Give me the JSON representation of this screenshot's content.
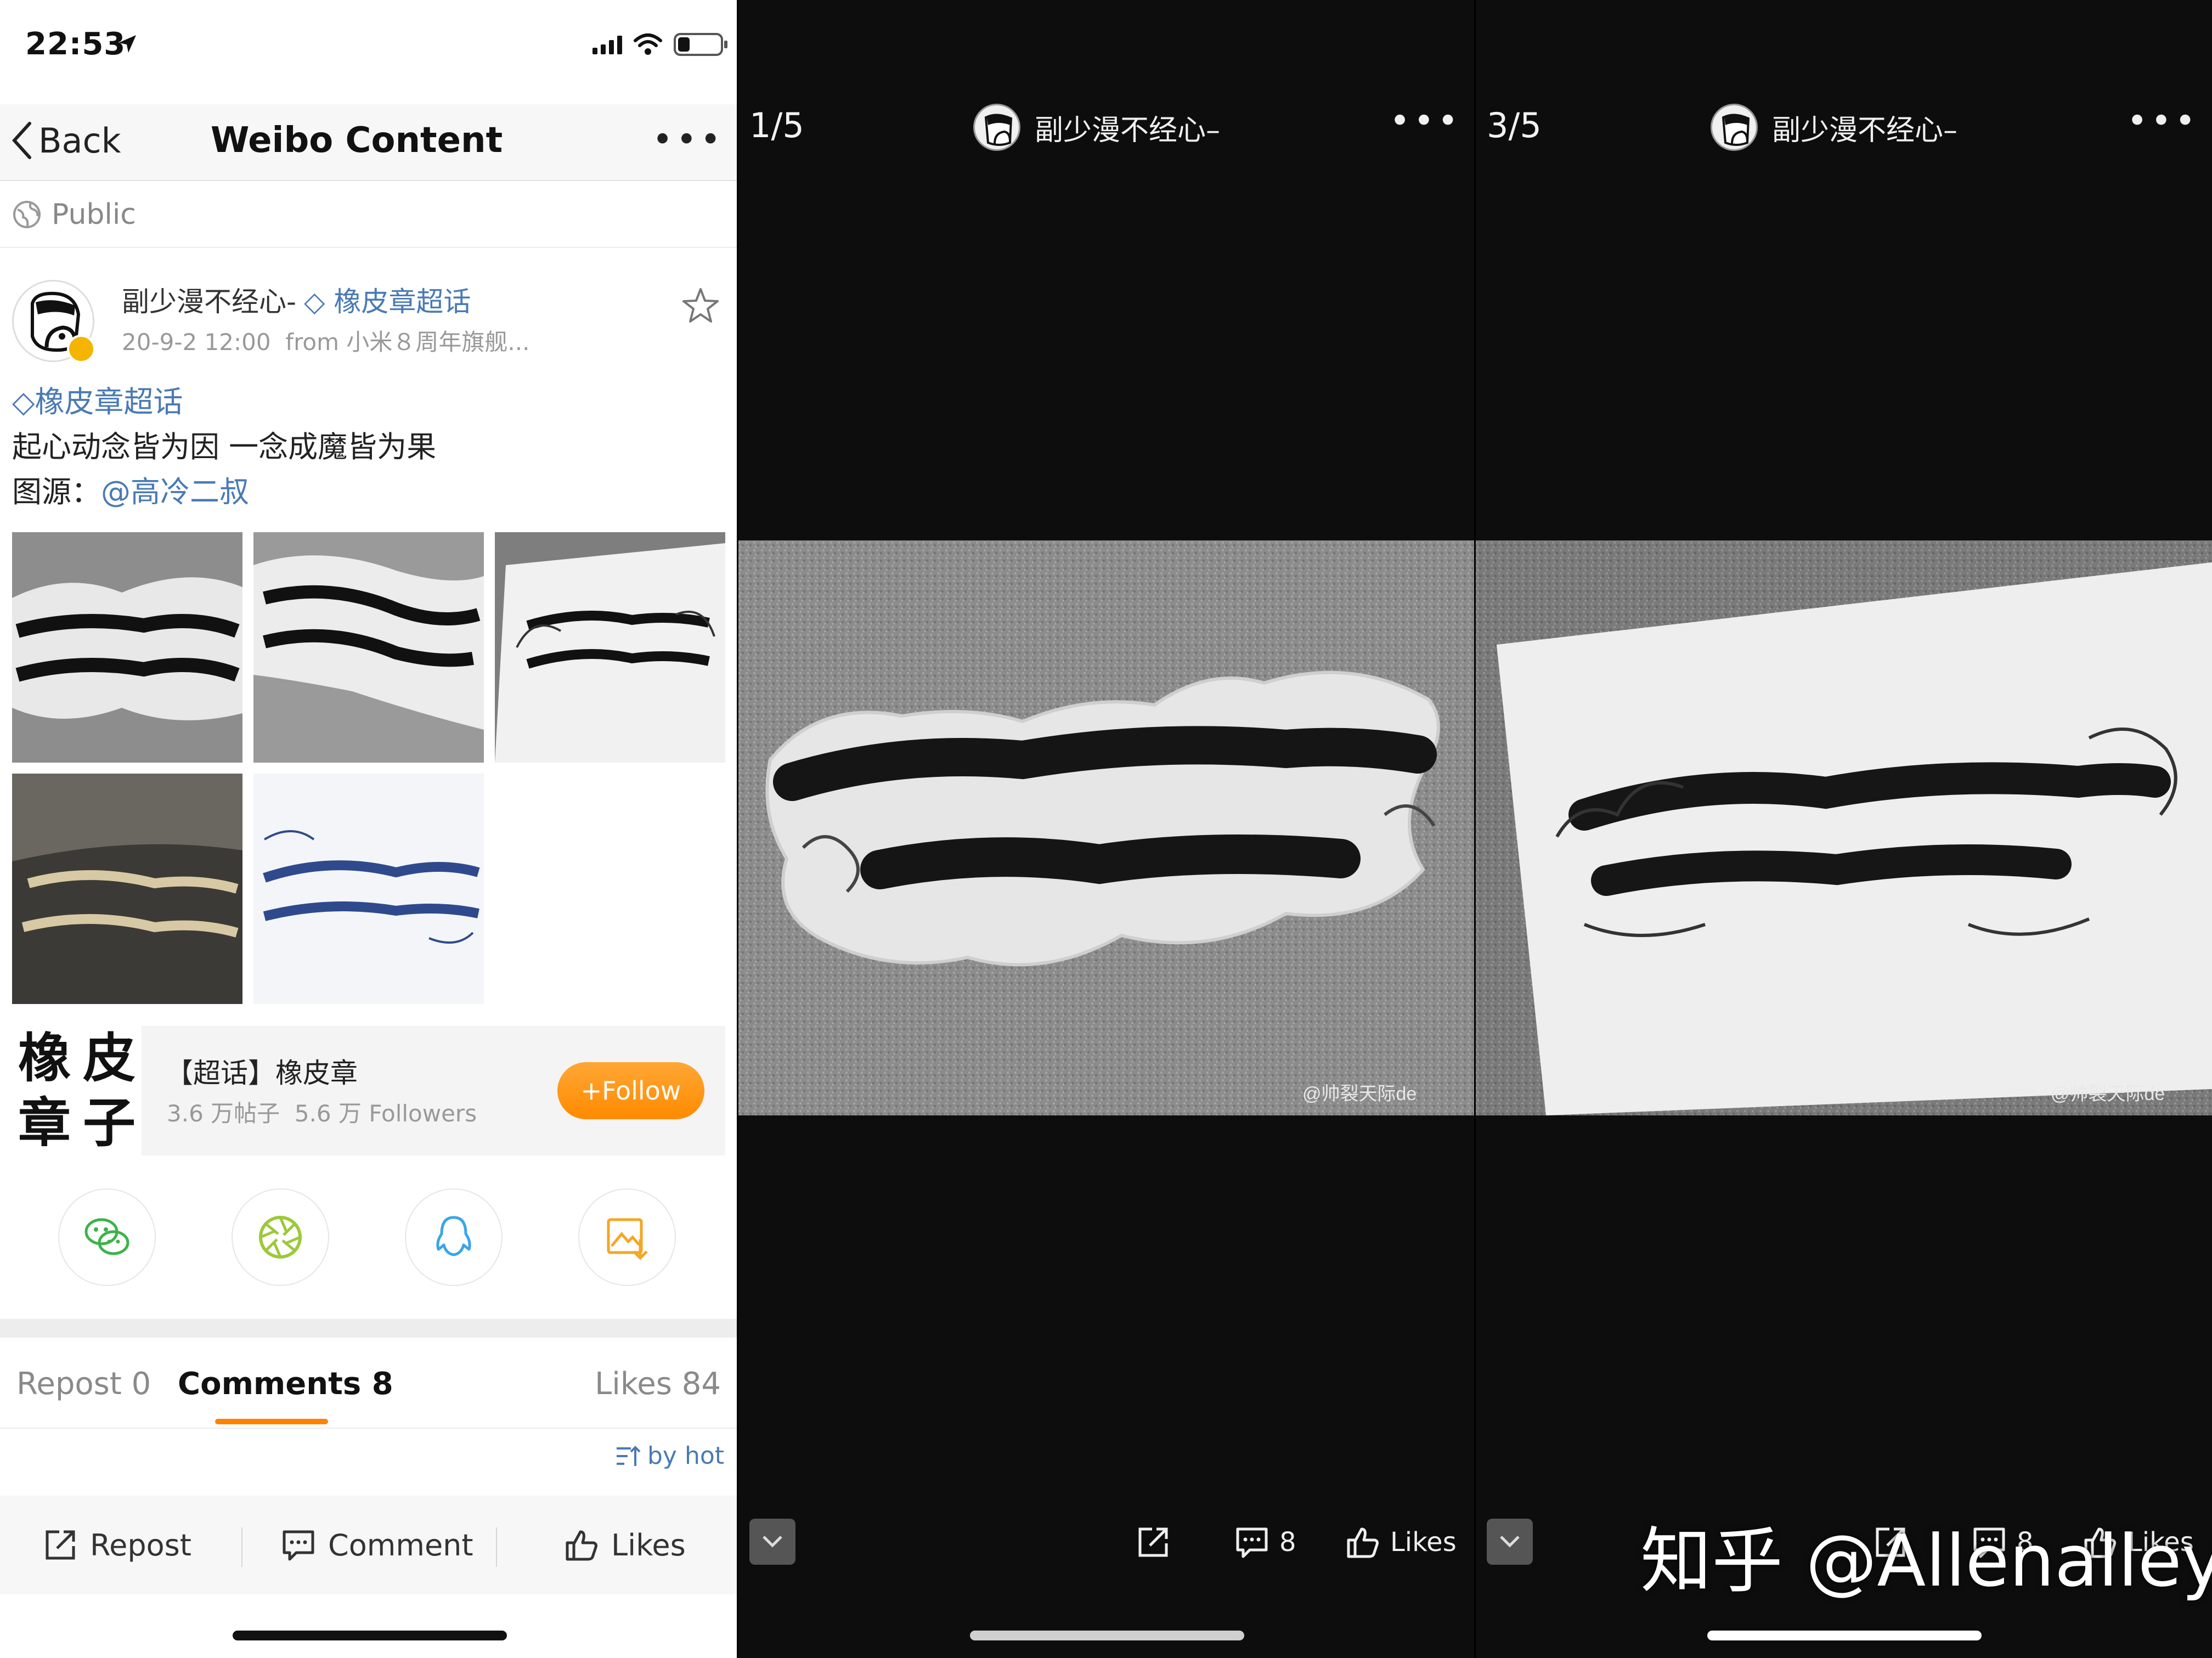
{
  "status_bar": {
    "time": "22:53"
  },
  "nav": {
    "back_label": "Back",
    "title": "Weibo Content",
    "more_label": "•••"
  },
  "visibility": {
    "label": "Public"
  },
  "post": {
    "author_name": "副少漫不经心-",
    "topic_tag": "橡皮章超话",
    "time": "20-9-2 12:00",
    "source": "from 小米８周年旗舰...",
    "topic_link": "橡皮章超话",
    "text_line": "起心动念皆为因 一念成魔皆为果",
    "source_label": "图源：",
    "source_mention": "@高冷二叔"
  },
  "topic_card": {
    "logo_chars": [
      "橡",
      "皮",
      "章",
      "子"
    ],
    "name": "【超话】橡皮章",
    "posts": "3.6 万帖子",
    "followers": "5.6 万 Followers",
    "follow_label": "+Follow"
  },
  "share": {
    "wechat": "wechat-icon",
    "moments": "moments-icon",
    "qq": "qq-icon",
    "save": "save-image-icon"
  },
  "tabs": {
    "repost": "Repost 0",
    "comments": "Comments 8",
    "likes": "Likes 84"
  },
  "sort_label": "by hot",
  "bottom_bar": {
    "repost": "Repost",
    "comment": "Comment",
    "likes": "Likes"
  },
  "viewer_1": {
    "counter": "1/5",
    "author": "副少漫不经心–",
    "more_label": "•••",
    "comment_count": "8",
    "likes_label": "Likes",
    "photo_watermark": "@帅裂天际de"
  },
  "viewer_2": {
    "counter": "3/5",
    "author": "副少漫不经心–",
    "more_label": "•••",
    "comment_count": "8",
    "likes_label": "Likes",
    "photo_watermark": "@帅裂天际de"
  },
  "site_watermark": "知乎 @Allenalley",
  "colors": {
    "accent_orange": "#ff8200",
    "link_blue": "#4a7ab5",
    "viewer_bg": "#0d0d0d"
  }
}
